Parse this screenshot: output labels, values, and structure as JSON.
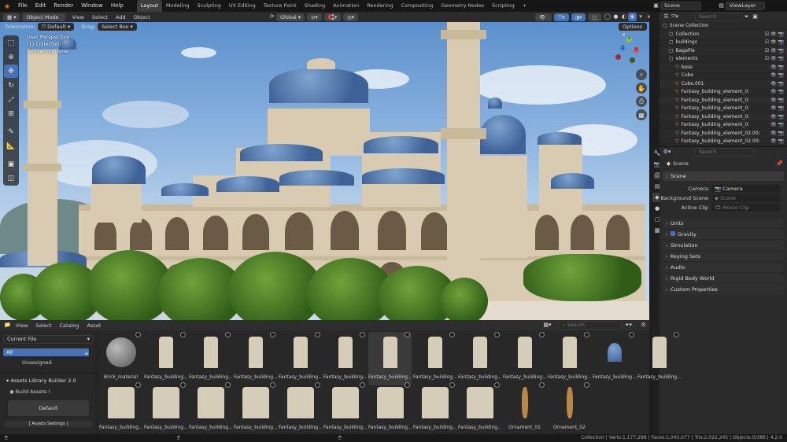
{
  "menu": [
    "File",
    "Edit",
    "Render",
    "Window",
    "Help"
  ],
  "workspaces": [
    "Layout",
    "Modeling",
    "Sculpting",
    "UV Editing",
    "Texture Paint",
    "Shading",
    "Animation",
    "Rendering",
    "Compositing",
    "Geometry Nodes",
    "Scripting"
  ],
  "active_workspace": "Layout",
  "scene_name": "Scene",
  "view_layer": "ViewLayer",
  "viewport": {
    "mode": "Object Mode",
    "menus": [
      "View",
      "Select",
      "Add",
      "Object"
    ],
    "transform_orientation": "Global",
    "orientation_label": "Orientation:",
    "orientation_value": "Default",
    "drag_label": "Drag:",
    "drag_value": "Select Box",
    "options_label": "Options",
    "overlay_lines": [
      "User Perspective",
      "(1) Collection",
      "Rendering Done"
    ]
  },
  "asset_browser": {
    "menus": [
      "View",
      "Select",
      "Catalog",
      "Asset"
    ],
    "library": "Current File",
    "catalogs": [
      "All",
      "Unassigned"
    ],
    "search_placeholder": "Search",
    "addon_panel_title": "Assets Library Builder 2.0",
    "build_label": "Build Assets !",
    "default_button": "Default",
    "settings_label": "[ Assets Settings ]",
    "row1": [
      "Brick_material",
      "Fantasy_building...",
      "Fantasy_building...",
      "Fantasy_building...",
      "Fantasy_building...",
      "Fantasy_building...",
      "Fantasy_building...",
      "Fantasy_building...",
      "Fantasy_building...",
      "Fantasy_building...",
      "Fantasy_building...",
      "Fantasy_building...",
      "Fantasy_building..."
    ],
    "row2": [
      "Fantasy_building...",
      "Fantasy_building...",
      "Fantasy_building...",
      "Fantasy_building...",
      "Fantasy_building...",
      "Fantasy_building...",
      "Fantasy_building...",
      "Fantasy_building...",
      "Fantasy_building...",
      "Ornament_01",
      "Ornament_02"
    ]
  },
  "outliner": {
    "search_placeholder": "Search",
    "rows": [
      {
        "label": "Scene Collection",
        "indent": 0,
        "icon": "collection-icon"
      },
      {
        "label": "Collection",
        "indent": 1,
        "icon": "collection-icon"
      },
      {
        "label": "buildings",
        "indent": 1,
        "icon": "collection-icon"
      },
      {
        "label": "BagaPie",
        "indent": 1,
        "icon": "collection-icon"
      },
      {
        "label": "elements",
        "indent": 1,
        "icon": "collection-icon"
      },
      {
        "label": "base",
        "indent": 2,
        "icon": "mesh-icon"
      },
      {
        "label": "Cube",
        "indent": 2,
        "icon": "mesh-icon"
      },
      {
        "label": "Cube.001",
        "indent": 2,
        "icon": "mesh-icon"
      },
      {
        "label": "Fantasy_building_element_0:",
        "indent": 2,
        "icon": "mesh-icon"
      },
      {
        "label": "Fantasy_building_element_0:",
        "indent": 2,
        "icon": "mesh-icon"
      },
      {
        "label": "Fantasy_building_element_0:",
        "indent": 2,
        "icon": "mesh-icon"
      },
      {
        "label": "Fantasy_building_element_0:",
        "indent": 2,
        "icon": "mesh-icon"
      },
      {
        "label": "Fantasy_building_element_0:",
        "indent": 2,
        "icon": "mesh-icon"
      },
      {
        "label": "Fantasy_building_element_02.00:",
        "indent": 2,
        "icon": "mesh-icon"
      },
      {
        "label": "Fantasy_building_element_02.00:",
        "indent": 2,
        "icon": "mesh-icon"
      }
    ]
  },
  "properties": {
    "search_placeholder": "Search",
    "breadcrumb": "Scene",
    "section": "Scene",
    "camera_label": "Camera",
    "camera_value": "Camera",
    "background_label": "Background Scene",
    "background_value": "Scene",
    "clip_label": "Active Clip",
    "clip_value": "Movie Clip",
    "panels": [
      "Units",
      "Gravity",
      "Simulation",
      "Keying Sets",
      "Audio",
      "Rigid Body World",
      "Custom Properties"
    ]
  },
  "status": "Collection | Verts:1,177,298 | Faces:1,045,077 | Tris:2,022,245 | Objects:0/386 | 4.2.0"
}
